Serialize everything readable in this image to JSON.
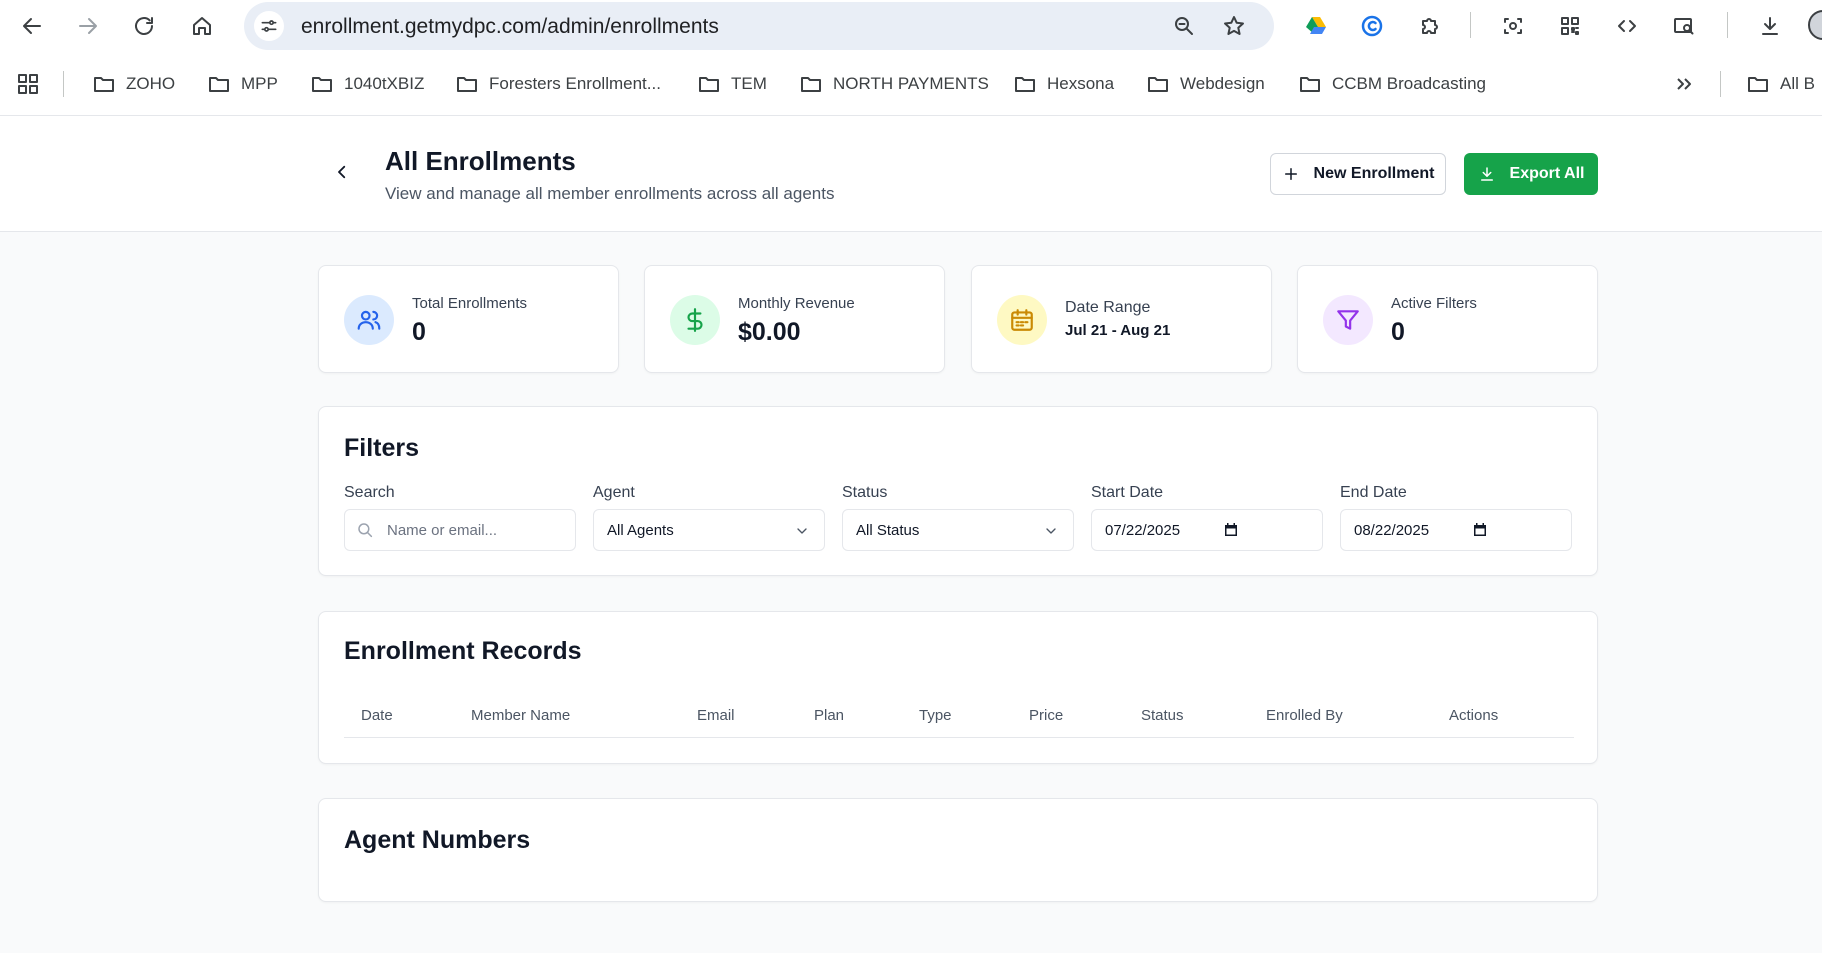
{
  "browser": {
    "url": "enrollment.getmydpc.com/admin/enrollments",
    "icons": [
      "back-arrow-icon",
      "forward-arrow-icon",
      "reload-icon",
      "home-icon",
      "site-settings-icon",
      "zoom-icon",
      "star-icon",
      "google-drive-icon",
      "extension-c-icon",
      "puzzle-icon",
      "screenshot-icon",
      "qr-code-icon",
      "code-icon",
      "search-page-icon",
      "download-icon"
    ],
    "bookmarks": [
      "ZOHO",
      "MPP",
      "1040tXBIZ",
      "Foresters Enrollment...",
      "TEM",
      "NORTH PAYMENTS",
      "Hexsona",
      "Webdesign",
      "CCBM Broadcasting"
    ],
    "all_bookmarks_label": "All B"
  },
  "header": {
    "title": "All Enrollments",
    "subtitle": "View and manage all member enrollments across all agents",
    "new_button": "New Enrollment",
    "export_button": "Export All"
  },
  "stats": [
    {
      "label": "Total Enrollments",
      "value": "0",
      "icon": "users-icon",
      "color": "#2563eb",
      "bg": "#dbeafe"
    },
    {
      "label": "Monthly Revenue",
      "value": "$0.00",
      "icon": "dollar-icon",
      "color": "#16a34a",
      "bg": "#dcfce7"
    },
    {
      "label": "Date Range",
      "value": "Jul 21 - Aug 21",
      "icon": "calendar-icon",
      "color": "#ca8a04",
      "bg": "#fef9c3"
    },
    {
      "label": "Active Filters",
      "value": "0",
      "icon": "filter-icon",
      "color": "#9333ea",
      "bg": "#f3e8ff"
    }
  ],
  "filters": {
    "title": "Filters",
    "search": {
      "label": "Search",
      "placeholder": "Name or email..."
    },
    "agent": {
      "label": "Agent",
      "value": "All Agents"
    },
    "status": {
      "label": "Status",
      "value": "All Status"
    },
    "start_date": {
      "label": "Start Date",
      "value": "07/22/2025"
    },
    "end_date": {
      "label": "End Date",
      "value": "08/22/2025"
    }
  },
  "records": {
    "title": "Enrollment Records",
    "columns": [
      "Date",
      "Member Name",
      "Email",
      "Plan",
      "Type",
      "Price",
      "Status",
      "Enrolled By",
      "Actions"
    ],
    "rows": []
  },
  "agent_numbers": {
    "title": "Agent Numbers"
  },
  "colors": {
    "accent_green": "#16a34a",
    "page_bg": "#f9fafb",
    "border": "#e5e7eb"
  }
}
